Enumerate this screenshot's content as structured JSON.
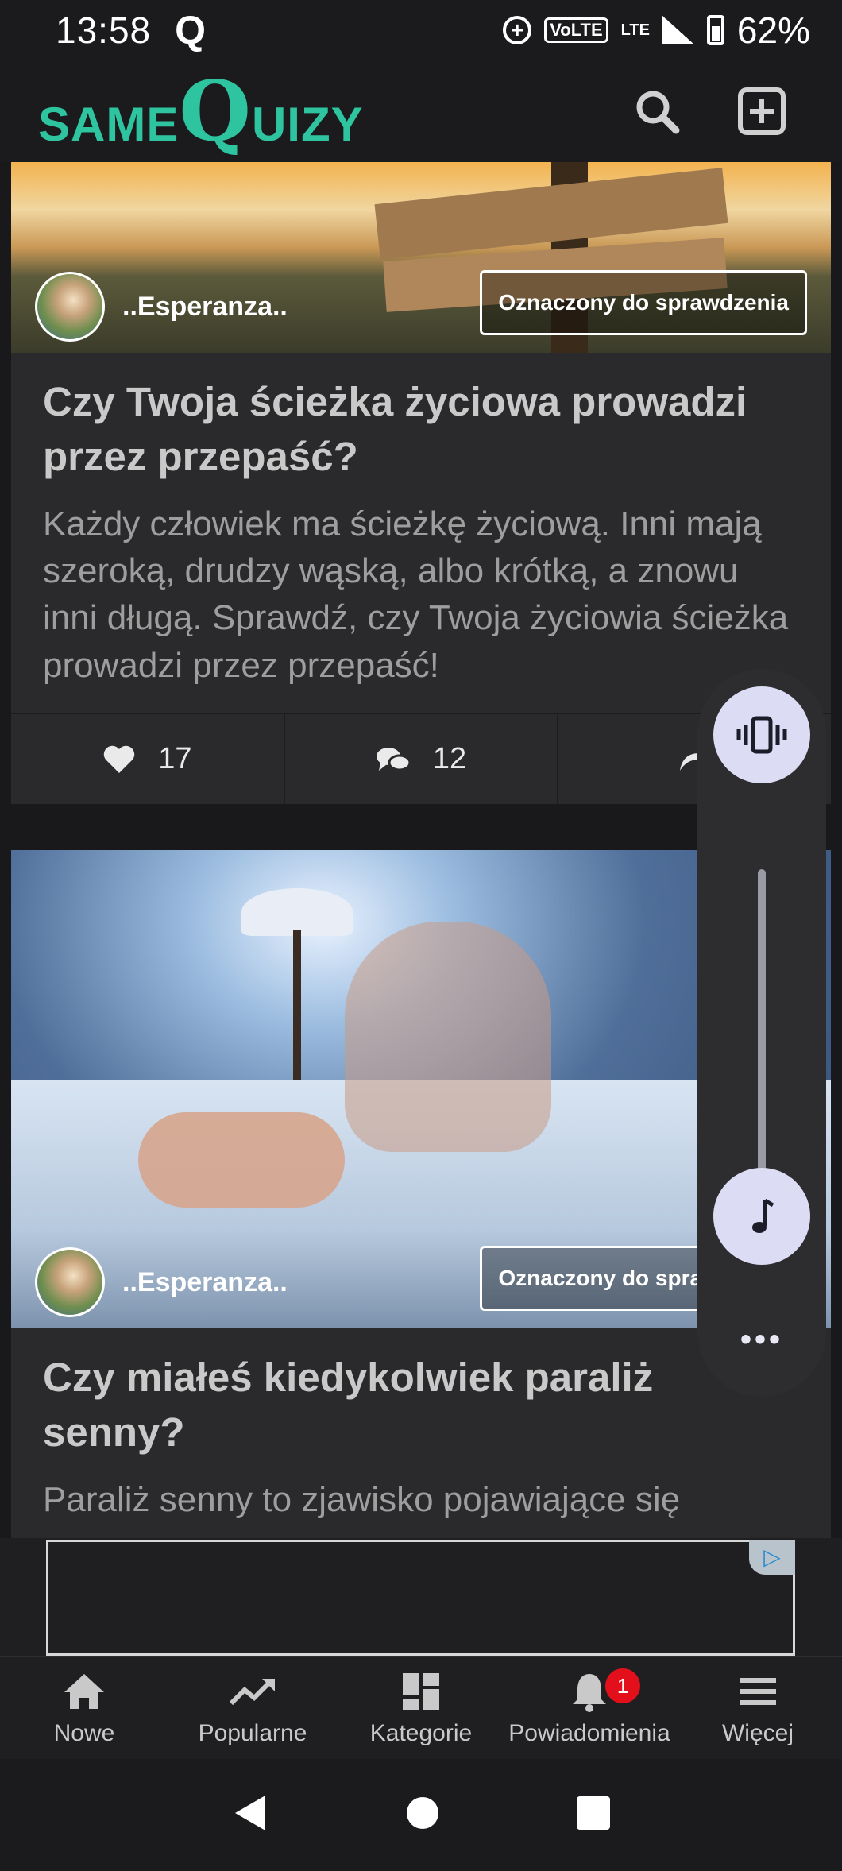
{
  "status_bar": {
    "time": "13:58",
    "app_indicator": "Q",
    "volte": "VoLTE",
    "lte": "LTE",
    "battery": "62%"
  },
  "header": {
    "logo_same": "SAME",
    "logo_q": "Q",
    "logo_uizy": "UIZY",
    "icons": [
      "search-icon",
      "add-box-icon"
    ]
  },
  "cards": [
    {
      "author": "..Esperanza..",
      "tag_label": "Oznaczony do sprawdzenia",
      "title": "Czy Twoja ścieżka życiowa prowadzi przez przepaść?",
      "description": "Każdy człowiek ma ścieżkę życiową. Inni mają szeroką, drudzy wąską, albo krótką, a znowu inni długą. Sprawdź, czy Twoja życiowia ścieżka prowadzi przez przepaść!",
      "likes": "17",
      "comments": "12"
    },
    {
      "author": "..Esperanza..",
      "tag_label": "Oznaczony do sprawdzenia",
      "title": "Czy miałeś kiedykolwiek paraliż senny?",
      "description": "Paraliż senny to zjawisko pojawiające się"
    }
  ],
  "bottom_nav": {
    "items": [
      {
        "label": "Nowe",
        "icon": "home-icon"
      },
      {
        "label": "Popularne",
        "icon": "trending-icon"
      },
      {
        "label": "Kategorie",
        "icon": "grid-icon"
      },
      {
        "label": "Powiadomienia",
        "icon": "bell-icon",
        "badge": "1"
      },
      {
        "label": "Więcej",
        "icon": "menu-icon"
      }
    ]
  },
  "volume_panel": {
    "more": "•••",
    "icons": [
      "vibrate-icon",
      "music-note-icon"
    ]
  },
  "colors": {
    "brand": "#2ec4a0",
    "badge": "#e3101c"
  }
}
